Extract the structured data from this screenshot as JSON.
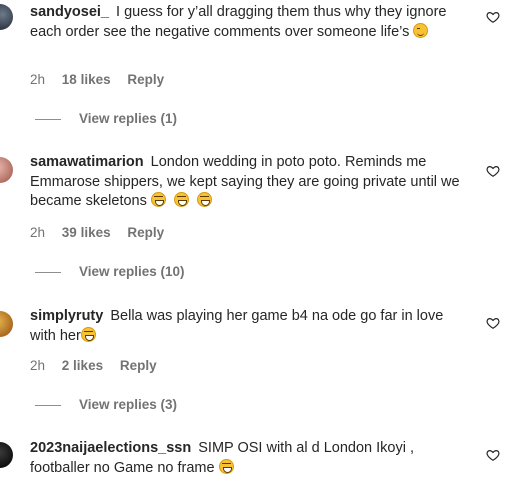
{
  "comments": [
    {
      "username": "sandyosei_",
      "text": "I guess for y’all dragging them thus why they ignore each order see the negative comments over someone life’s",
      "emoji": "winking-face",
      "time": "2h",
      "likes": "18 likes",
      "reply": "Reply",
      "view_replies": "View replies (1)"
    },
    {
      "username": "samawatimarion",
      "text": "London wedding in poto poto. Reminds me Emmarose shippers, we kept saying they are going private until we became skeletons",
      "emoji": "face-with-tears-of-joy x3",
      "time": "2h",
      "likes": "39 likes",
      "reply": "Reply",
      "view_replies": "View replies (10)"
    },
    {
      "username": "simplyruty",
      "text": "Bella was playing her game b4 na ode go far in love with her",
      "emoji": "face-with-tears-of-joy",
      "time": "2h",
      "likes": "2 likes",
      "reply": "Reply",
      "view_replies": "View replies (3)"
    },
    {
      "username": "2023naijaelections_ssn",
      "text": "SIMP OSI with al d London Ikoyi , footballer no Game no frame",
      "emoji": "face-with-tears-of-joy"
    }
  ],
  "icons": {
    "like": "heart-outline-icon"
  },
  "colors": {
    "text": "#262626",
    "secondary": "#737373",
    "background": "#ffffff"
  }
}
